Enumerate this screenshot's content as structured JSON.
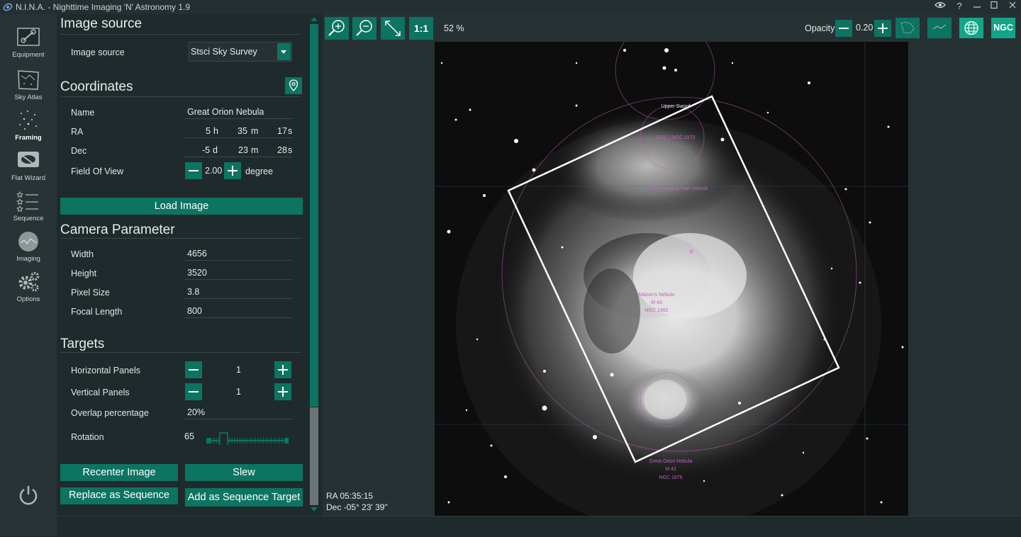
{
  "app": {
    "title": "N.I.N.A. - Nighttime Imaging 'N' Astronomy 1.9"
  },
  "sidebar": {
    "items": [
      {
        "label": "Equipment",
        "icon": "camera-plug-icon",
        "active": false
      },
      {
        "label": "Sky Atlas",
        "icon": "sky-atlas-icon",
        "active": false
      },
      {
        "label": "Framing",
        "icon": "framing-icon",
        "active": true
      },
      {
        "label": "Flat Wizard",
        "icon": "flat-wizard-icon",
        "active": false
      },
      {
        "label": "Sequence",
        "icon": "sequence-icon",
        "active": false
      },
      {
        "label": "Imaging",
        "icon": "imaging-icon",
        "active": false
      },
      {
        "label": "Options",
        "icon": "gears-icon",
        "active": false
      }
    ],
    "power_icon": "power-icon"
  },
  "image_source": {
    "section_title": "Image source",
    "label": "Image source",
    "selected": "Stsci Sky Survey"
  },
  "coordinates": {
    "section_title": "Coordinates",
    "name_label": "Name",
    "name_value": "Great Orion Nebula",
    "ra_label": "RA",
    "ra_h": "5",
    "ra_h_unit": "h",
    "ra_m": "35",
    "ra_m_unit": "m",
    "ra_s": "17",
    "ra_s_unit": "s",
    "dec_label": "Dec",
    "dec_d": "-5",
    "dec_d_unit": "d",
    "dec_m": "23",
    "dec_m_unit": "m",
    "dec_s": "28",
    "dec_s_unit": "s",
    "fov_label": "Field Of View",
    "fov_value": "2.00",
    "fov_unit": "degree"
  },
  "load_image_label": "Load Image",
  "camera": {
    "section_title": "Camera Parameter",
    "width_label": "Width",
    "width_value": "4656",
    "height_label": "Height",
    "height_value": "3520",
    "pixel_label": "Pixel Size",
    "pixel_value": "3.8",
    "focal_label": "Focal Length",
    "focal_value": "800"
  },
  "targets": {
    "section_title": "Targets",
    "hpanels_label": "Horizontal Panels",
    "hpanels_value": "1",
    "vpanels_label": "Vertical Panels",
    "vpanels_value": "1",
    "overlap_label": "Overlap percentage",
    "overlap_value": "20%",
    "rotation_label": "Rotation",
    "rotation_value": "65"
  },
  "actions": {
    "recenter": "Recenter Image",
    "slew": "Slew",
    "replace": "Replace as Sequence",
    "add_target": "Add as Sequence Target"
  },
  "viewer": {
    "zoom_one_to_one": "1:1",
    "zoom_percent": "52 %",
    "opacity_label": "Opacity",
    "opacity_value": "0.20",
    "ngc_label": "NGC",
    "ra_readout": "RA  05:35:15",
    "dec_readout": "Dec  -05° 23' 39\""
  },
  "annotations": {
    "upper_sword": "Upper Sword",
    "ngc1973": "NGC / NGC 1973",
    "running_man": "The Running Man Nebula",
    "mairan": "Mairan's Nebula",
    "m43": "M 43",
    "ngc1982": "NGC 1982",
    "great_orion": "Great Orion Nebula",
    "m42": "M 42",
    "ngc1976": "NGC 1976"
  },
  "colors": {
    "accent": "#0c7461",
    "background": "#1f2a2c",
    "annotation": "#c060c0"
  }
}
